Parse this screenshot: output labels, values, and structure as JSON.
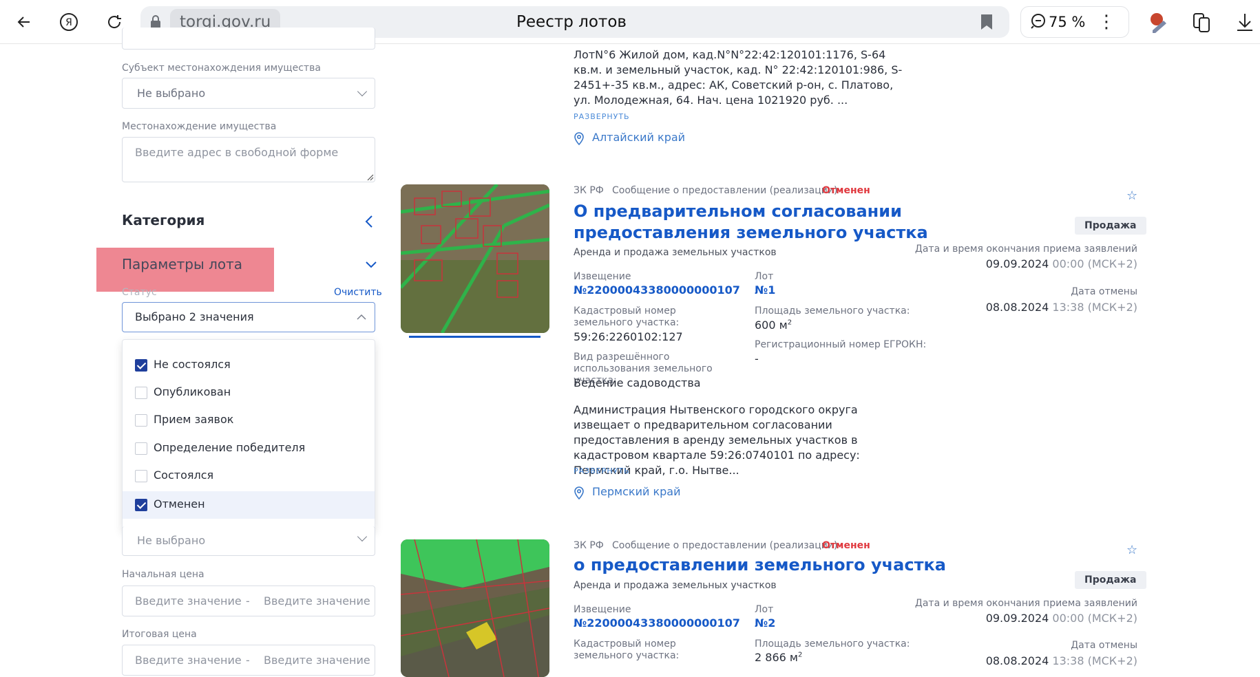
{
  "browser": {
    "domain": "torgi.gov.ru",
    "page_title": "Реестр лотов",
    "zoom": "75 %"
  },
  "filters": {
    "subject_label": "Субъект местонахождения имущества",
    "subject_value": "Не выбрано",
    "location_label": "Местонахождение имущества",
    "location_placeholder": "Введите адрес в свободной форме",
    "category_heading": "Категория",
    "lot_params_heading": "Параметры лота",
    "status_label": "Статус",
    "clear_label": "Очистить",
    "status_value": "Выбрано 2 значения",
    "status_options": [
      {
        "label": "Не состоялся",
        "checked": true
      },
      {
        "label": "Опубликован",
        "checked": false
      },
      {
        "label": "Прием заявок",
        "checked": false
      },
      {
        "label": "Определение победителя",
        "checked": false
      },
      {
        "label": "Состоялся",
        "checked": false
      },
      {
        "label": "Отменен",
        "checked": true
      }
    ],
    "hidden_select_value": "Не выбрано",
    "start_price_label": "Начальная цена",
    "final_price_label": "Итоговая цена",
    "value_placeholder": "Введите значение",
    "range_dash": "-"
  },
  "cards": [
    {
      "description": "ЛотN°6 Жилой дом, кад.N°N°22:42:120101:1176, S-64 кв.м. и земельный участок, кад. N° 22:42:120101:986, S- 2451+-35 кв.м., адрес: АК, Советский р-он, с. Платово, ул. Молодежная, 64. Нач. цена 1021920 руб. ...",
      "expand": "РАЗВЕРНУТЬ",
      "region": "Алтайский край"
    },
    {
      "law": "ЗК РФ",
      "type": "Сообщение о предоставлении (реализации)",
      "status": "Отменен",
      "title": "О предварительном согласовании предоставления земельного участка",
      "subtitle": "Аренда и продажа земельных участков",
      "notice_label": "Извещение",
      "notice_value": "№22000043380000000107",
      "lot_label": "Лот",
      "lot_value": "№1",
      "cadastral_label": "Кадастровый номер земельного участка:",
      "cadastral_value": "59:26:2260102:127",
      "area_label": "Площадь земельного участка:",
      "area_value": "600 м",
      "area_sup": "2",
      "egrokn_label": "Регистрационный номер ЕГРОКН:",
      "egrokn_value": "-",
      "usage_label": "Вид разрешённого использования земельного участка:",
      "usage_value": "Ведение садоводства",
      "description": "Администрация Нытвенского городского округа извещает о предварительном согласовании предоставления в аренду земельных участков в кадастровом квартале 59:26:0740101 по адресу: Пермский край, г.о. Нытве...",
      "expand": "РАЗВЕРНУТЬ",
      "region": "Пермский край",
      "badge": "Продажа",
      "deadline_label": "Дата и время окончания приема заявлений",
      "deadline_date": "09.09.2024",
      "deadline_time": "00:00 (МСК+2)",
      "cancel_label": "Дата отмены",
      "cancel_date": "08.08.2024",
      "cancel_time": "13:38 (МСК+2)"
    },
    {
      "law": "ЗК РФ",
      "type": "Сообщение о предоставлении (реализации)",
      "status": "Отменен",
      "title": "о предоставлении земельного участка",
      "subtitle": "Аренда и продажа земельных участков",
      "notice_label": "Извещение",
      "notice_value": "№22000043380000000107",
      "lot_label": "Лот",
      "lot_value": "№2",
      "cadastral_label": "Кадастровый номер земельного участка:",
      "area_label": "Площадь земельного участка:",
      "area_value": "2 866 м",
      "area_sup": "2",
      "badge": "Продажа",
      "deadline_label": "Дата и время окончания приема заявлений",
      "deadline_date": "09.09.2024",
      "deadline_time": "00:00 (МСК+2)",
      "cancel_label": "Дата отмены",
      "cancel_date": "08.08.2024",
      "cancel_time": "13:38 (МСК+2)"
    }
  ]
}
